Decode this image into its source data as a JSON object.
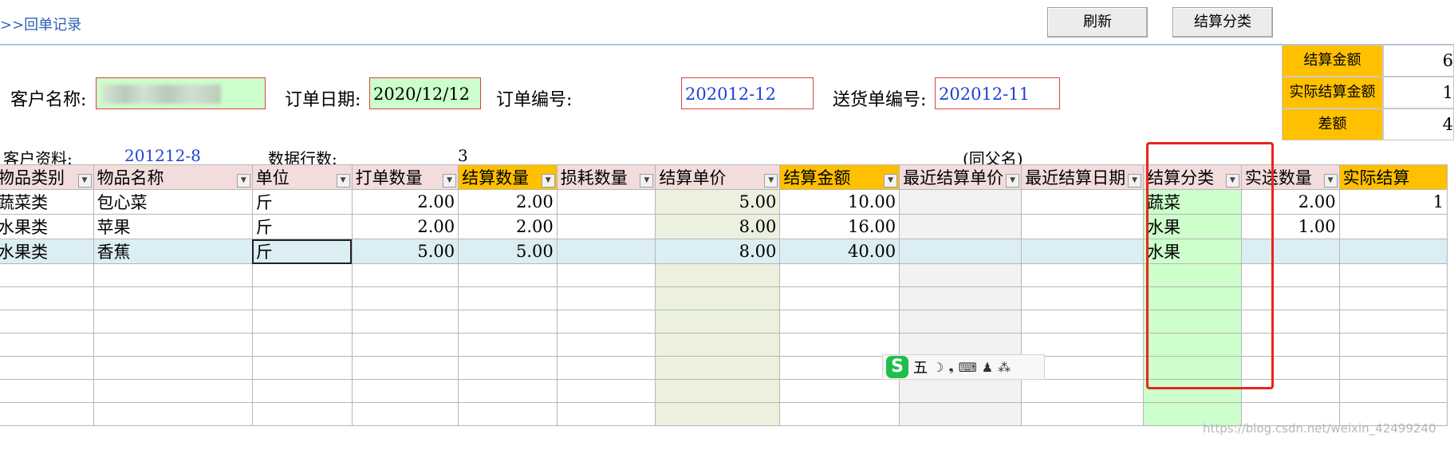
{
  "breadcrumb": ">>回单记录",
  "buttons": {
    "refresh": "刷新",
    "classify": "结算分类"
  },
  "form": {
    "customer_name_label": "客户名称:",
    "order_date_label": "订单日期:",
    "order_date_value": "2020/12/12",
    "order_no_label": "订单编号:",
    "order_no_value": "202012-12",
    "delivery_no_label": "送货单编号:",
    "delivery_no_value": "202012-11"
  },
  "summary": [
    {
      "label": "结算金额",
      "value": "6"
    },
    {
      "label": "实际结算金额",
      "value": "1"
    },
    {
      "label": "差额",
      "value": "4"
    }
  ],
  "info": {
    "customer_info_label": "客户资料:",
    "customer_info_value": "201212-8",
    "row_count_label": "数据行数:",
    "row_count_value": "3",
    "same_parent_note": "(同父名)"
  },
  "table": {
    "headers": [
      "物品类别",
      "物品名称",
      "单位",
      "打单数量",
      "结算数量",
      "损耗数量",
      "结算单价",
      "结算金额",
      "最近结算单价",
      "最近结算日期",
      "结算分类",
      "实送数量",
      "实际结算"
    ],
    "rows": [
      [
        "蔬菜类",
        "包心菜",
        "斤",
        "2.00",
        "2.00",
        "",
        "5.00",
        "10.00",
        "",
        "",
        "蔬菜",
        "2.00",
        "1"
      ],
      [
        "水果类",
        "苹果",
        "斤",
        "2.00",
        "2.00",
        "",
        "8.00",
        "16.00",
        "",
        "",
        "水果",
        "1.00",
        ""
      ],
      [
        "水果类",
        "香蕉",
        "斤",
        "5.00",
        "5.00",
        "",
        "8.00",
        "40.00",
        "",
        "",
        "水果",
        "",
        ""
      ]
    ],
    "empty_rows": 7
  },
  "ime_toolbar": {
    "logo": "S",
    "mode": "五",
    "glyphs": [
      "☽",
      "❟",
      "⌨",
      "♟",
      "⁂"
    ]
  },
  "watermark": "https://blog.csdn.net/weixin_42499240"
}
